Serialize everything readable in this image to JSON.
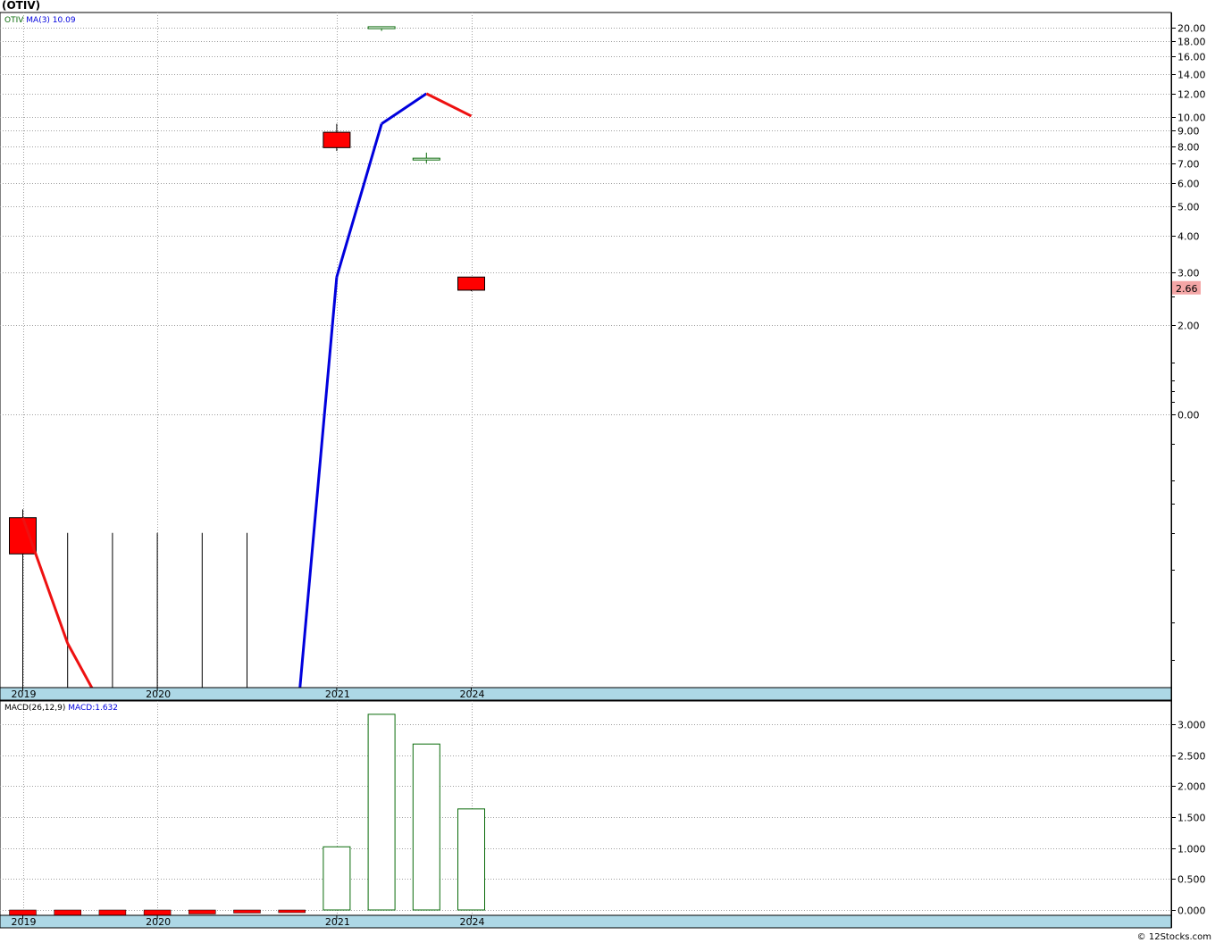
{
  "title": "(OTIV)",
  "footer": "© 12Stocks.com",
  "colors": {
    "up": "#0a6b0a",
    "down": "#ff0000",
    "ma_up": "#0000dd",
    "ma_down": "#ee1111",
    "axis_band": "#add8e6",
    "grid": "#a0a0a0",
    "last_price_bg": "#f4a6a6"
  },
  "chart_data": [
    {
      "type": "candlestick",
      "name": "price-panel",
      "legend": {
        "symbol": "OTIV",
        "ma_label": "MA(3)",
        "ma_value": "10.09"
      },
      "scale": "log",
      "x_labels": [
        {
          "bar": 0,
          "label": "2019"
        },
        {
          "bar": 3,
          "label": "2020"
        },
        {
          "bar": 7,
          "label": "2021"
        },
        {
          "bar": 10,
          "label": "2024"
        }
      ],
      "y_ticks": [
        "20.00",
        "18.00",
        "16.00",
        "14.00",
        "12.00",
        "10.00",
        "9.00",
        "8.00",
        "7.00",
        "6.00",
        "5.00",
        "4.00",
        "3.00",
        "2.00",
        "0.00"
      ],
      "last_price": "2.66",
      "bars": [
        {
          "open": 0.45,
          "high": 0.48,
          "low": 0.008,
          "close": 0.34,
          "color": "down"
        },
        {
          "open": 0.06,
          "high": 0.4,
          "low": 0.008,
          "close": 0.06,
          "color": "flat"
        },
        {
          "open": 0.06,
          "high": 0.4,
          "low": 0.008,
          "close": 0.06,
          "color": "flat"
        },
        {
          "open": 0.06,
          "high": 0.4,
          "low": 0.008,
          "close": 0.06,
          "color": "flat"
        },
        {
          "open": 0.06,
          "high": 0.4,
          "low": 0.008,
          "close": 0.06,
          "color": "flat"
        },
        {
          "open": 0.06,
          "high": 0.4,
          "low": 0.008,
          "close": 0.06,
          "color": "flat"
        },
        {
          "open": 0.06,
          "high": 0.06,
          "low": 0.06,
          "close": 0.06,
          "color": "flat"
        },
        {
          "open": 8.9,
          "high": 9.5,
          "low": 7.7,
          "close": 7.9,
          "color": "down"
        },
        {
          "open": 19.85,
          "high": 20.2,
          "low": 19.5,
          "close": 20.15,
          "color": "up"
        },
        {
          "open": 7.28,
          "high": 7.6,
          "low": 7.0,
          "close": 7.28,
          "color": "up"
        },
        {
          "open": 2.9,
          "high": 2.9,
          "low": 2.6,
          "close": 2.62,
          "color": "down"
        }
      ],
      "ma": [
        0.45,
        0.17,
        0.09,
        0.06,
        0.06,
        0.06,
        0.06,
        2.9,
        9.5,
        12.0,
        10.09
      ]
    },
    {
      "type": "bar",
      "name": "macd-panel",
      "legend": {
        "label": "MACD(26,12,9)",
        "value_label": "MACD:1.632"
      },
      "x_labels": [
        {
          "bar": 0,
          "label": "2019"
        },
        {
          "bar": 3,
          "label": "2020"
        },
        {
          "bar": 7,
          "label": "2021"
        },
        {
          "bar": 10,
          "label": "2024"
        }
      ],
      "y_ticks": [
        "3.000",
        "2.500",
        "2.000",
        "1.500",
        "1.000",
        "0.500",
        "0.000"
      ],
      "ylim": [
        -0.1,
        3.3
      ],
      "values": [
        -0.085,
        -0.085,
        -0.085,
        -0.085,
        -0.065,
        -0.05,
        -0.025,
        1.02,
        3.16,
        2.68,
        1.632
      ]
    }
  ]
}
